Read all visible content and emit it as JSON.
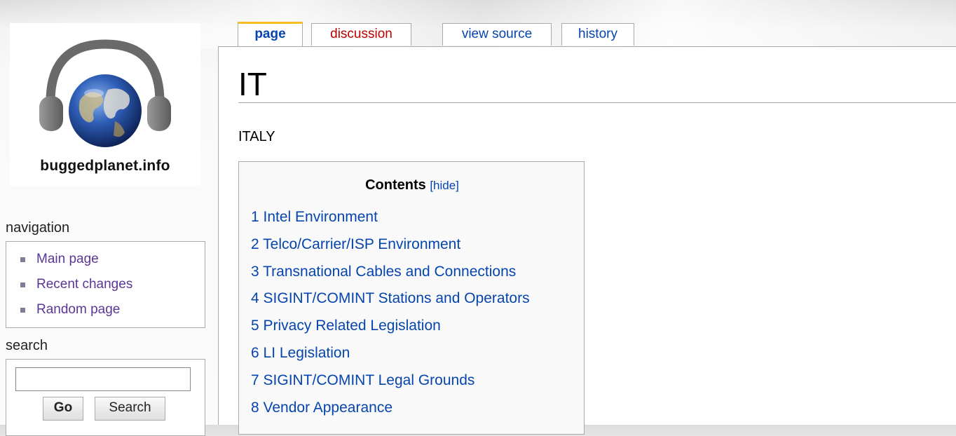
{
  "site": {
    "logo_text": "buggedplanet.info",
    "logo_icon": "earth-headphones-icon"
  },
  "navigation": {
    "title": "navigation",
    "items": [
      {
        "label": "Main page"
      },
      {
        "label": "Recent changes"
      },
      {
        "label": "Random page"
      }
    ]
  },
  "search": {
    "title": "search",
    "value": "",
    "placeholder": "",
    "go_label": "Go",
    "search_label": "Search"
  },
  "tabs": {
    "page": "page",
    "discussion": "discussion",
    "view_source": "view source",
    "history": "history"
  },
  "article": {
    "title": "IT",
    "subtitle": "ITALY"
  },
  "toc": {
    "title": "Contents",
    "hide_label": "[hide]",
    "items": [
      {
        "label": "1 Intel Environment"
      },
      {
        "label": "2 Telco/Carrier/ISP Environment"
      },
      {
        "label": "3 Transnational Cables and Connections"
      },
      {
        "label": "4 SIGINT/COMINT Stations and Operators"
      },
      {
        "label": "5 Privacy Related Legislation"
      },
      {
        "label": "6 LI Legislation"
      },
      {
        "label": "7 SIGINT/COMINT Legal Grounds"
      },
      {
        "label": "8 Vendor Appearance"
      }
    ]
  },
  "colors": {
    "link": "#0645ad",
    "visited_link": "#5a3696",
    "new_link": "#ba0000",
    "active_tab_accent": "#fabd23"
  }
}
